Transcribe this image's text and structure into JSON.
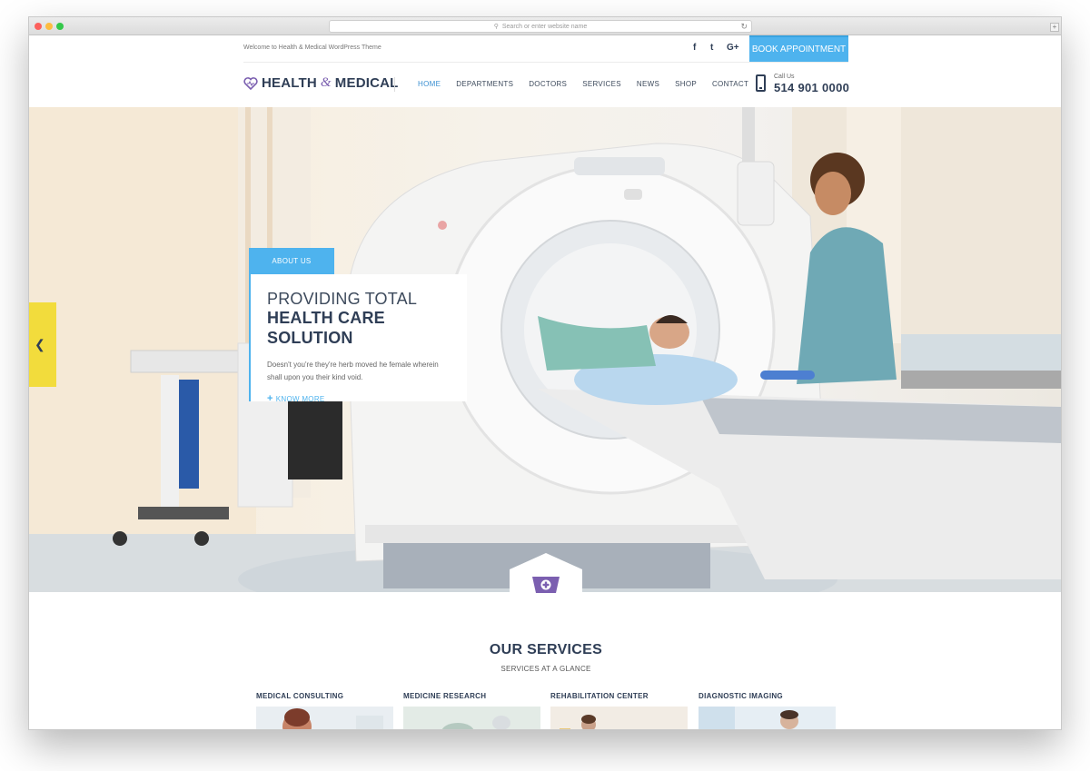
{
  "browser": {
    "url_placeholder": "Search or enter website name",
    "new_tab": "+"
  },
  "topbar": {
    "welcome": "Welcome to Health & Medical WordPress Theme",
    "social": [
      "f",
      "t",
      "G+"
    ],
    "book_button": "BOOK APPOINTMENT"
  },
  "header": {
    "logo_part1": "HEALTH",
    "logo_amp": "&",
    "logo_part2": "MEDICAL",
    "nav": [
      {
        "label": "HOME",
        "active": true
      },
      {
        "label": "DEPARTMENTS",
        "active": false
      },
      {
        "label": "DOCTORS",
        "active": false
      },
      {
        "label": "SERVICES",
        "active": false
      },
      {
        "label": "NEWS",
        "active": false
      },
      {
        "label": "SHOP",
        "active": false
      },
      {
        "label": "CONTACT",
        "active": false
      }
    ],
    "call_label": "Call Us",
    "call_number": "514 901 0000"
  },
  "hero": {
    "tab": "ABOUT US",
    "line1": "PROVIDING TOTAL",
    "line2": "HEALTH CARE SOLUTION",
    "text": "Doesn't you're they're herb moved he female wherein shall upon you their kind void.",
    "link": "KNOW MORE"
  },
  "services": {
    "title": "OUR SERVICES",
    "subtitle": "SERVICES AT A GLANCE",
    "items": [
      {
        "title": "MEDICAL CONSULTING"
      },
      {
        "title": "MEDICINE RESEARCH"
      },
      {
        "title": "REHABILITATION CENTER"
      },
      {
        "title": "DIAGNOSTIC IMAGING"
      }
    ]
  },
  "colors": {
    "accent": "#4eb3ee",
    "dark": "#2f3e56",
    "purple": "#7b5fb0"
  }
}
